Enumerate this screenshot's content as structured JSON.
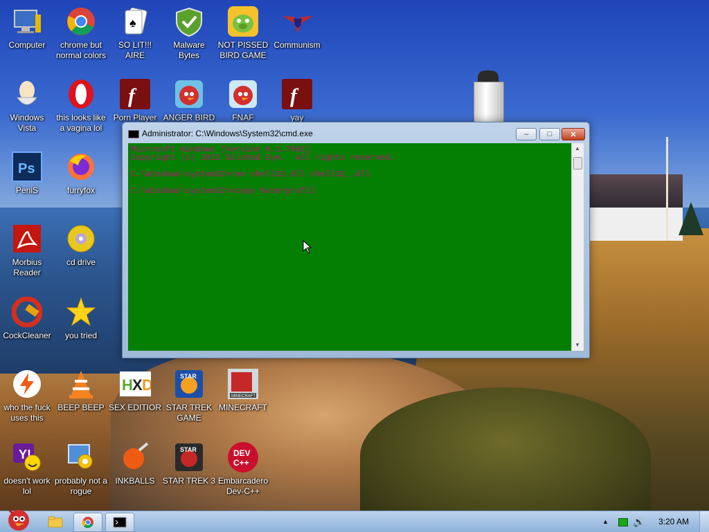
{
  "desktop": {
    "icons": [
      {
        "label": "Computer",
        "icon": "computer-icon"
      },
      {
        "label": "chrome but normal colors",
        "icon": "chrome-icon"
      },
      {
        "label": "SO LIT!!! AIRE",
        "icon": "solitaire-icon"
      },
      {
        "label": "Malware Bytes",
        "icon": "shield-icon"
      },
      {
        "label": "NOT PISSED BIRD GAME",
        "icon": "pig-icon"
      },
      {
        "label": "Communism",
        "icon": "emblem-icon"
      },
      {
        "label": "Windows Vista",
        "icon": "egg-icon"
      },
      {
        "label": "this looks like a vagina lol",
        "icon": "opera-icon"
      },
      {
        "label": "Porn Player",
        "icon": "flash-icon"
      },
      {
        "label": "ANGER BIRD",
        "icon": "angry-bird-icon"
      },
      {
        "label": "FNAF",
        "icon": "angry-bird-icon"
      },
      {
        "label": "yay",
        "icon": "flash-icon"
      },
      {
        "label": "PeniS",
        "icon": "photoshop-icon"
      },
      {
        "label": "furryfox",
        "icon": "firefox-icon"
      },
      {
        "label": "Morbius Reader",
        "icon": "pdf-icon"
      },
      {
        "label": "cd drive",
        "icon": "cd-icon"
      },
      {
        "label": "CockCleaner",
        "icon": "ccleaner-icon"
      },
      {
        "label": "you tried",
        "icon": "star-icon"
      },
      {
        "label": "who the fuck uses this",
        "icon": "lightning-icon"
      },
      {
        "label": "BEEP BEEP",
        "icon": "vlc-icon"
      },
      {
        "label": "SEX EDITIOR",
        "icon": "hxd-icon"
      },
      {
        "label": "STAR TREK GAME",
        "icon": "starwars-icon"
      },
      {
        "label": "MINECRAFT",
        "icon": "minecraft-icon"
      },
      {
        "label": "doesn't work lol",
        "icon": "yahoo-icon"
      },
      {
        "label": "probably not a rogue",
        "icon": "control-panel-icon"
      },
      {
        "label": "INKBALLS",
        "icon": "inkball-icon"
      },
      {
        "label": "STAR TREK 3",
        "icon": "starwars-icon"
      },
      {
        "label": "Embarcadero Dev-C++",
        "icon": "devcpp-icon"
      }
    ]
  },
  "cmd_window": {
    "title": "Administrator: C:\\Windows\\System32\\cmd.exe",
    "minimize_label": "–",
    "maximize_label": "□",
    "close_label": "✕",
    "lines": [
      "Microsoft Windows [Version 6.1.7601]",
      "Copyright (c) 2012 Dilshad Eye.  All rights reserved.",
      "",
      "C:\\Windows\\system32>ren shell32.dll shell32_.dll",
      "",
      "C:\\Windows\\system32>xcopy %userprofil"
    ],
    "background_color": "#047f04",
    "text_color": "#c2107a"
  },
  "taskbar": {
    "start_icon": "angry-bird-icon",
    "pinned": [
      {
        "icon": "folder-icon"
      },
      {
        "icon": "chrome-icon"
      },
      {
        "icon": "cmd-icon"
      }
    ],
    "clock": "3:20 AM"
  }
}
